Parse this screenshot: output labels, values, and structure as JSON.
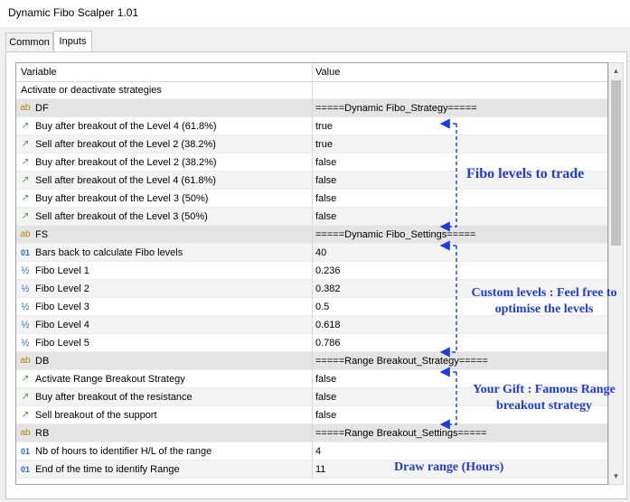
{
  "window": {
    "title": "Dynamic Fibo Scalper 1.01"
  },
  "tabs": [
    {
      "label": "Common"
    },
    {
      "label": "Inputs"
    }
  ],
  "table": {
    "headers": {
      "variable": "Variable",
      "value": "Value"
    },
    "rows": [
      {
        "icon": "none",
        "name": "Activate or deactivate strategies",
        "value": ""
      },
      {
        "icon": "ab",
        "name": "DF",
        "value": "=====Dynamic Fibo_Strategy====="
      },
      {
        "icon": "arrow",
        "name": "Buy after breakout of the Level 4 (61.8%)",
        "value": "true"
      },
      {
        "icon": "arrow",
        "name": "Sell after breakout of the Level 2 (38.2%)",
        "value": "true"
      },
      {
        "icon": "arrow",
        "name": "Buy after breakout of the Level 2 (38.2%)",
        "value": "false"
      },
      {
        "icon": "arrow",
        "name": "Sell after breakout of the Level 4 (61.8%)",
        "value": "false"
      },
      {
        "icon": "arrow",
        "name": "Buy after breakout of the Level 3 (50%)",
        "value": "false"
      },
      {
        "icon": "arrow",
        "name": "Sell after breakout of the Level 3 (50%)",
        "value": "false"
      },
      {
        "icon": "ab",
        "name": "FS",
        "value": "=====Dynamic Fibo_Settings====="
      },
      {
        "icon": "01",
        "name": "Bars back to calculate Fibo levels",
        "value": "40"
      },
      {
        "icon": "half",
        "name": "Fibo Level 1",
        "value": "0.236"
      },
      {
        "icon": "half",
        "name": "Fibo Level 2",
        "value": "0.382"
      },
      {
        "icon": "half",
        "name": "Fibo Level 3",
        "value": "0.5"
      },
      {
        "icon": "half",
        "name": "Fibo Level 4",
        "value": "0.618"
      },
      {
        "icon": "half",
        "name": "Fibo Level 5",
        "value": "0.786"
      },
      {
        "icon": "ab",
        "name": "DB",
        "value": "=====Range Breakout_Strategy====="
      },
      {
        "icon": "arrow",
        "name": "Activate Range Breakout Strategy",
        "value": "false"
      },
      {
        "icon": "arrow",
        "name": "Buy after breakout of the resistance",
        "value": "false"
      },
      {
        "icon": "arrow",
        "name": "Sell breakout of the support",
        "value": "false"
      },
      {
        "icon": "ab",
        "name": "RB",
        "value": "=====Range Breakout_Settings====="
      },
      {
        "icon": "01",
        "name": "Nb of hours to identifier H/L of the range",
        "value": "4"
      },
      {
        "icon": "01",
        "name": "End of the time to identify Range",
        "value": "11"
      }
    ]
  },
  "icon_glyphs": {
    "ab": "ab",
    "01": "01",
    "half": "½",
    "arrow": "↗"
  },
  "annotations": {
    "fibo_levels": "Fibo levels to trade",
    "custom_levels_1": "Custom levels : Feel free to",
    "custom_levels_2": "optimise the levels",
    "gift_1": "Your Gift : Famous Range",
    "gift_2": "breakout strategy",
    "draw_range": "Draw range (Hours)"
  },
  "colors": {
    "annotation": "#1f3cd8",
    "group_row": "#e4e4e4",
    "arrow_icon": "#2e9a2e",
    "number_icon": "#1c6fd1",
    "string_icon": "#b8860b"
  }
}
